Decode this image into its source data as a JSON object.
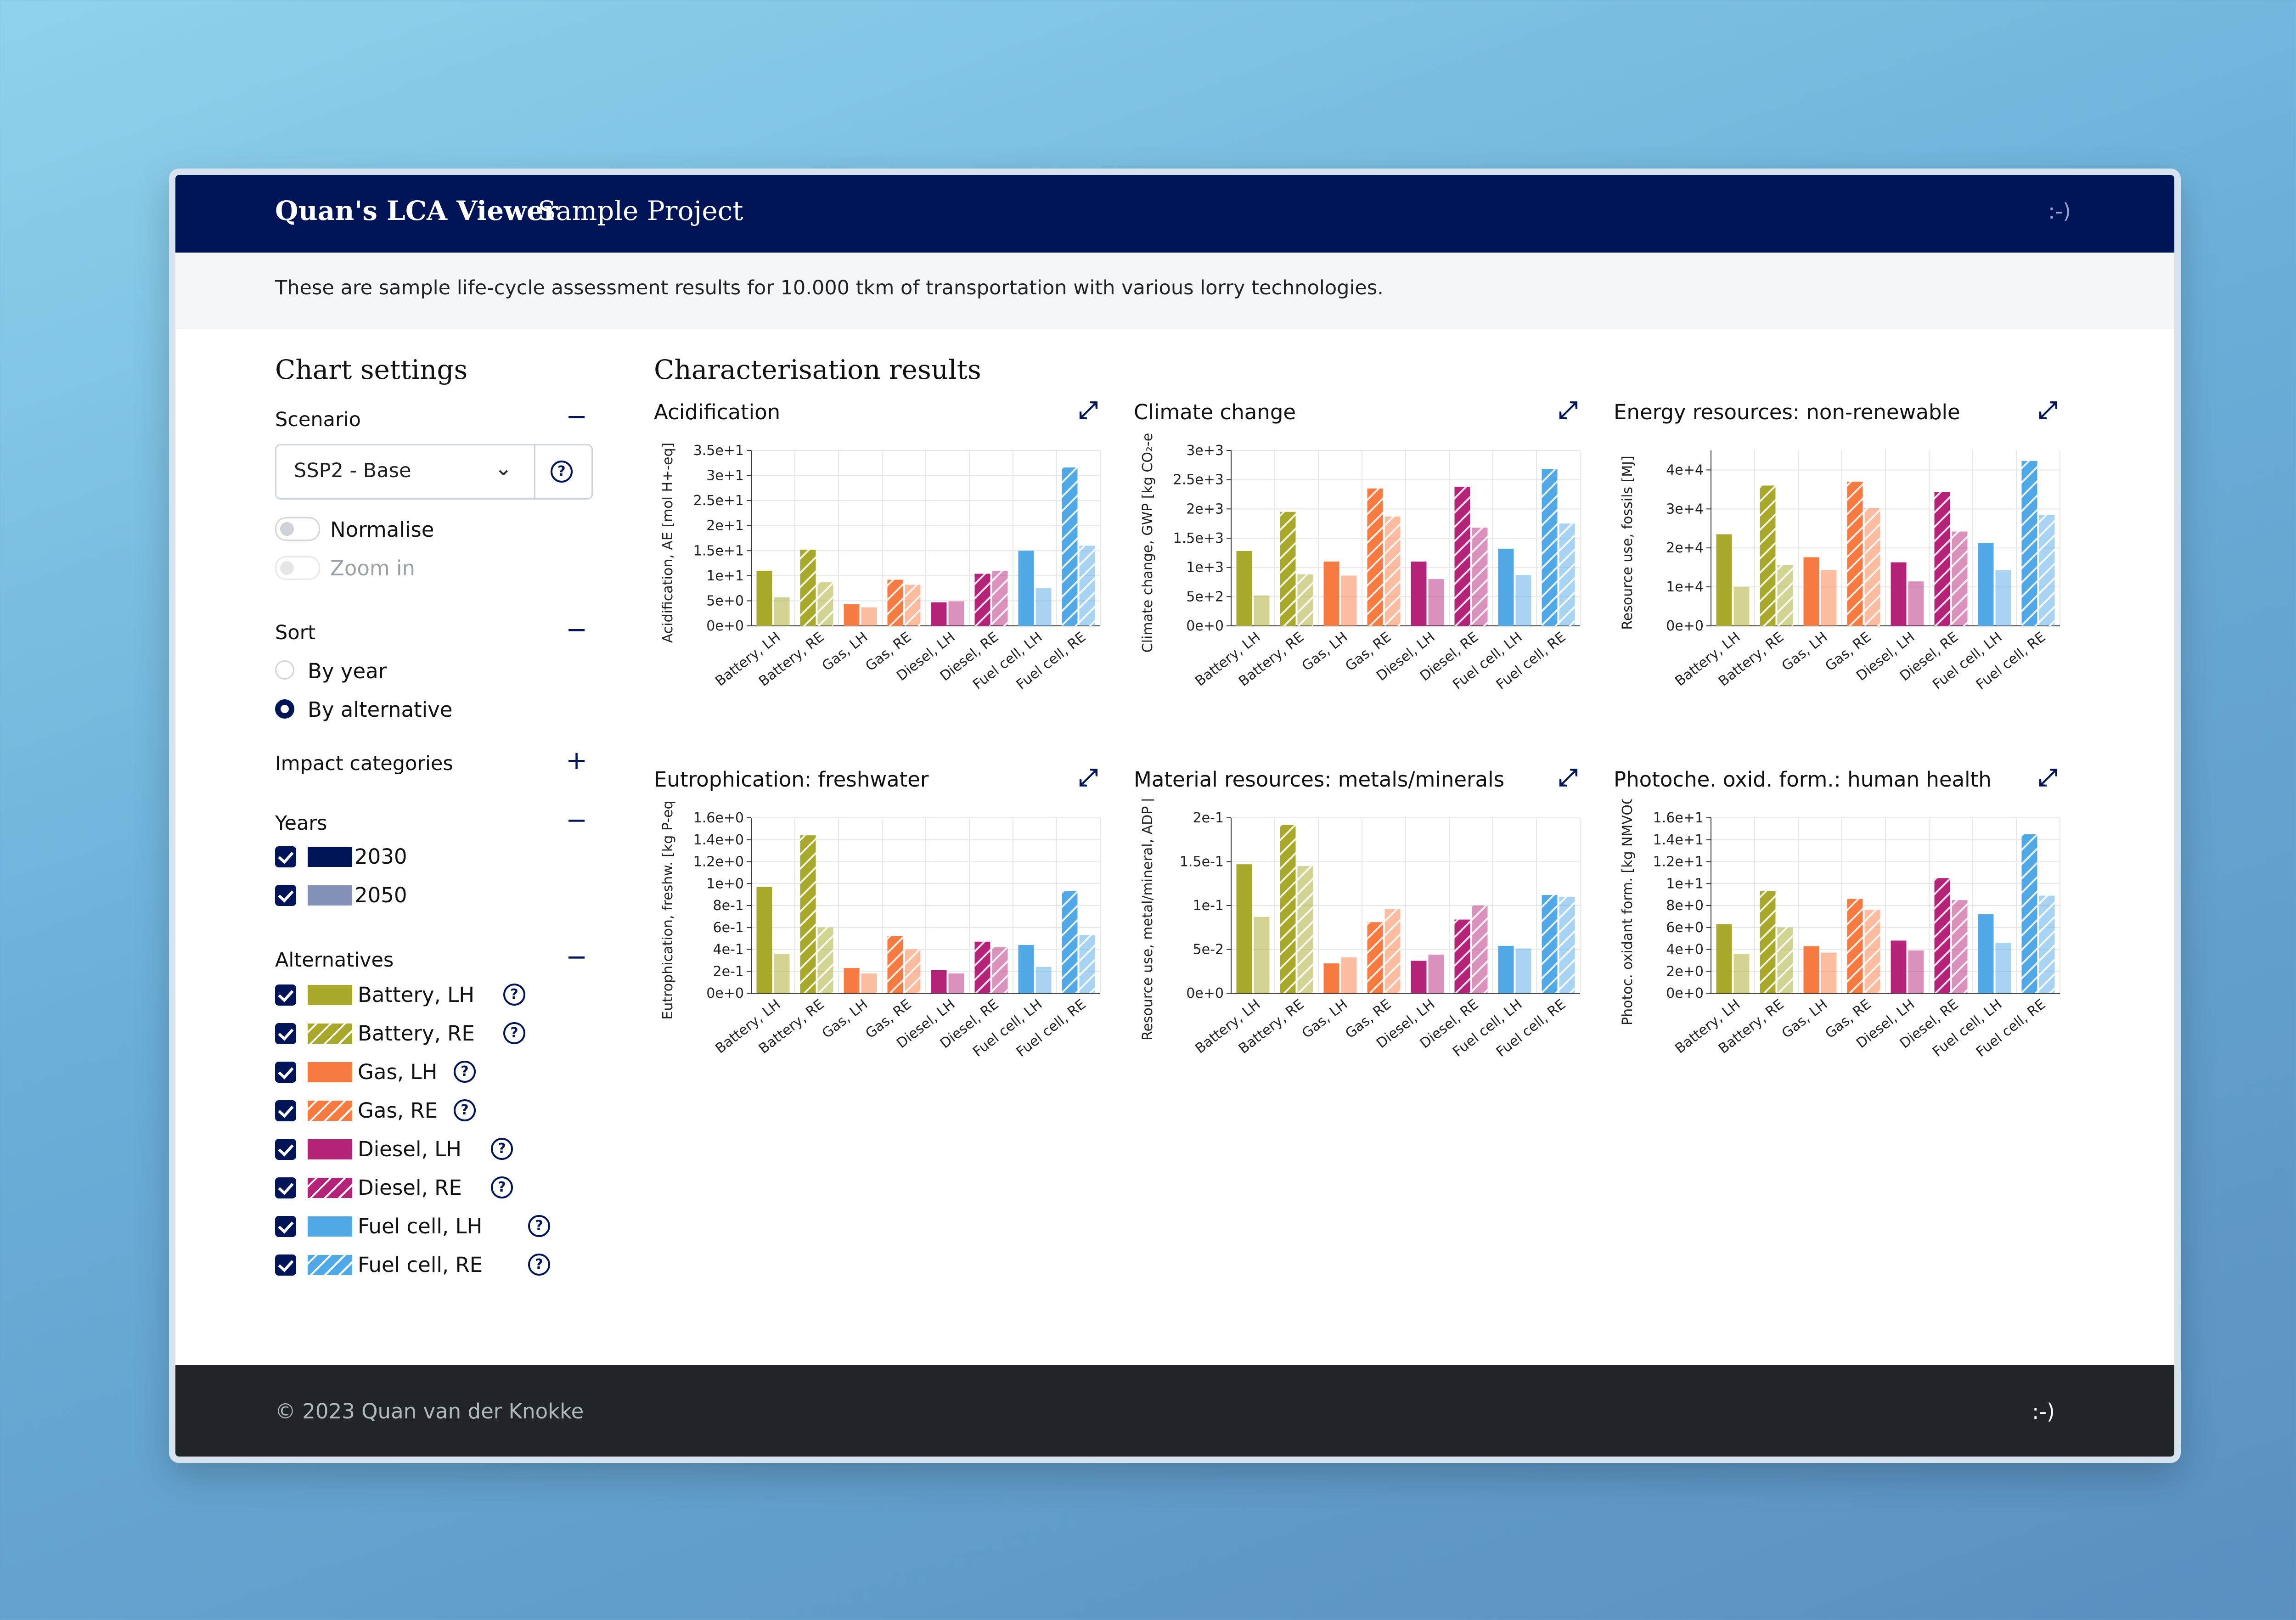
{
  "header": {
    "brand": "Quan's LCA Viewer",
    "project": "Sample Project",
    "smiley": ":-)"
  },
  "info": "These are sample life-cycle assessment results for 10.000 tkm of transportation with various lorry technologies.",
  "sidebar": {
    "title": "Chart settings",
    "scenario_label": "Scenario",
    "scenario_value": "SSP2 - Base",
    "normalise": "Normalise",
    "zoom": "Zoom in",
    "sort_label": "Sort",
    "sort_options": [
      "By year",
      "By alternative"
    ],
    "sort_selected": "By alternative",
    "impact_label": "Impact categories",
    "years_label": "Years",
    "years": [
      {
        "label": "2030",
        "color": "#001458"
      },
      {
        "label": "2050",
        "color": "#8590b8"
      }
    ],
    "alternatives_label": "Alternatives",
    "alternatives": [
      {
        "label": "Battery, LH",
        "color": "#a8a82a",
        "hatch": false
      },
      {
        "label": "Battery, RE",
        "color": "#a8a82a",
        "hatch": true
      },
      {
        "label": "Gas, LH",
        "color": "#f77a41",
        "hatch": false
      },
      {
        "label": "Gas, RE",
        "color": "#f77a41",
        "hatch": true
      },
      {
        "label": "Diesel, LH",
        "color": "#b52379",
        "hatch": false
      },
      {
        "label": "Diesel, RE",
        "color": "#b52379",
        "hatch": true
      },
      {
        "label": "Fuel cell, LH",
        "color": "#51a8e6",
        "hatch": false
      },
      {
        "label": "Fuel cell, RE",
        "color": "#51a8e6",
        "hatch": true
      }
    ]
  },
  "main_title": "Characterisation results",
  "chart_data": [
    {
      "type": "bar",
      "title": "Acidification",
      "ylabel": "Acidification, AE [mol H+-eq]",
      "categories": [
        "Battery, LH",
        "Battery, RE",
        "Gas, LH",
        "Gas, RE",
        "Diesel, LH",
        "Diesel, RE",
        "Fuel cell, LH",
        "Fuel cell, RE"
      ],
      "ylim": [
        0,
        35
      ],
      "yticks": [
        0,
        5,
        10,
        15,
        20,
        25,
        30,
        35
      ],
      "yticklabels": [
        "0e+0",
        "5e+0",
        "1e+1",
        "1.5e+1",
        "2e+1",
        "2.5e+1",
        "3e+1",
        "3.5e+1"
      ],
      "series": [
        {
          "name": "2030",
          "values": [
            11,
            15.2,
            4.3,
            9.2,
            4.7,
            10.4,
            15,
            31.6
          ]
        },
        {
          "name": "2050",
          "values": [
            5.7,
            8.8,
            3.7,
            8.2,
            4.9,
            11,
            7.5,
            16
          ]
        }
      ]
    },
    {
      "type": "bar",
      "title": "Climate change",
      "ylabel": "Climate change, GWP [kg CO₂-e",
      "categories": [
        "Battery, LH",
        "Battery, RE",
        "Gas, LH",
        "Gas, RE",
        "Diesel, LH",
        "Diesel, RE",
        "Fuel cell, LH",
        "Fuel cell, RE"
      ],
      "ylim": [
        0,
        3000
      ],
      "yticks": [
        0,
        500,
        1000,
        1500,
        2000,
        2500,
        3000
      ],
      "yticklabels": [
        "0e+0",
        "5e+2",
        "1e+3",
        "1.5e+3",
        "2e+3",
        "2.5e+3",
        "3e+3"
      ],
      "series": [
        {
          "name": "2030",
          "values": [
            1280,
            1950,
            1100,
            2350,
            1100,
            2380,
            1320,
            2680
          ]
        },
        {
          "name": "2050",
          "values": [
            520,
            880,
            860,
            1870,
            800,
            1680,
            870,
            1750
          ]
        }
      ]
    },
    {
      "type": "bar",
      "title": "Energy resources: non-renewable",
      "ylabel": "Resource use, fossils [MJ]",
      "categories": [
        "Battery, LH",
        "Battery, RE",
        "Gas, LH",
        "Gas, RE",
        "Diesel, LH",
        "Diesel, RE",
        "Fuel cell, LH",
        "Fuel cell, RE"
      ],
      "ylim": [
        0,
        45000
      ],
      "yticks": [
        0,
        10000,
        20000,
        30000,
        40000
      ],
      "yticklabels": [
        "0e+0",
        "1e+4",
        "2e+4",
        "3e+4",
        "4e+4"
      ],
      "series": [
        {
          "name": "2030",
          "values": [
            23500,
            36000,
            17600,
            37000,
            16300,
            34300,
            21300,
            42300
          ]
        },
        {
          "name": "2050",
          "values": [
            10000,
            15600,
            14300,
            30200,
            11400,
            24200,
            14300,
            28400
          ]
        }
      ]
    },
    {
      "type": "bar",
      "title": "Eutrophication: freshwater",
      "ylabel": "Eutrophication, freshw. [kg P-eq",
      "categories": [
        "Battery, LH",
        "Battery, RE",
        "Gas, LH",
        "Gas, RE",
        "Diesel, LH",
        "Diesel, RE",
        "Fuel cell, LH",
        "Fuel cell, RE"
      ],
      "ylim": [
        0,
        1.6
      ],
      "yticks": [
        0,
        0.2,
        0.4,
        0.6,
        0.8,
        1.0,
        1.2,
        1.4,
        1.6
      ],
      "yticklabels": [
        "0e+0",
        "2e-1",
        "4e-1",
        "6e-1",
        "8e-1",
        "1e+0",
        "1.2e+0",
        "1.4e+0",
        "1.6e+0"
      ],
      "series": [
        {
          "name": "2030",
          "values": [
            0.97,
            1.44,
            0.23,
            0.52,
            0.21,
            0.47,
            0.44,
            0.93
          ]
        },
        {
          "name": "2050",
          "values": [
            0.36,
            0.6,
            0.18,
            0.4,
            0.18,
            0.42,
            0.24,
            0.53
          ]
        }
      ]
    },
    {
      "type": "bar",
      "title": "Material resources: metals/minerals",
      "ylabel": "Resource use, metal/mineral, ADP [kg",
      "categories": [
        "Battery, LH",
        "Battery, RE",
        "Gas, LH",
        "Gas, RE",
        "Diesel, LH",
        "Diesel, RE",
        "Fuel cell, LH",
        "Fuel cell, RE"
      ],
      "ylim": [
        0,
        0.2
      ],
      "yticks": [
        0,
        0.05,
        0.1,
        0.15,
        0.2
      ],
      "yticklabels": [
        "0e+0",
        "5e-2",
        "1e-1",
        "1.5e-1",
        "2e-1"
      ],
      "series": [
        {
          "name": "2030",
          "values": [
            0.147,
            0.192,
            0.034,
            0.081,
            0.037,
            0.084,
            0.054,
            0.112
          ]
        },
        {
          "name": "2050",
          "values": [
            0.087,
            0.145,
            0.041,
            0.096,
            0.044,
            0.1,
            0.051,
            0.11
          ]
        }
      ]
    },
    {
      "type": "bar",
      "title": "Photoche. oxid. form.: human health",
      "ylabel": "Photoc. oxidant form. [kg NMVOC",
      "categories": [
        "Battery, LH",
        "Battery, RE",
        "Gas, LH",
        "Gas, RE",
        "Diesel, LH",
        "Diesel, RE",
        "Fuel cell, LH",
        "Fuel cell, RE"
      ],
      "ylim": [
        0,
        16
      ],
      "yticks": [
        0,
        2,
        4,
        6,
        8,
        10,
        12,
        14,
        16
      ],
      "yticklabels": [
        "0e+0",
        "2e+0",
        "4e+0",
        "6e+0",
        "8e+0",
        "1e+1",
        "1.2e+1",
        "1.4e+1",
        "1.6e+1"
      ],
      "series": [
        {
          "name": "2030",
          "values": [
            6.3,
            9.3,
            4.3,
            8.6,
            4.8,
            10.5,
            7.2,
            14.5
          ]
        },
        {
          "name": "2050",
          "values": [
            3.6,
            6.0,
            3.7,
            7.6,
            3.9,
            8.5,
            4.6,
            8.9
          ]
        }
      ]
    }
  ],
  "footer": {
    "copyright": "© 2023 Quan van der Knokke",
    "smiley": ":-)"
  }
}
